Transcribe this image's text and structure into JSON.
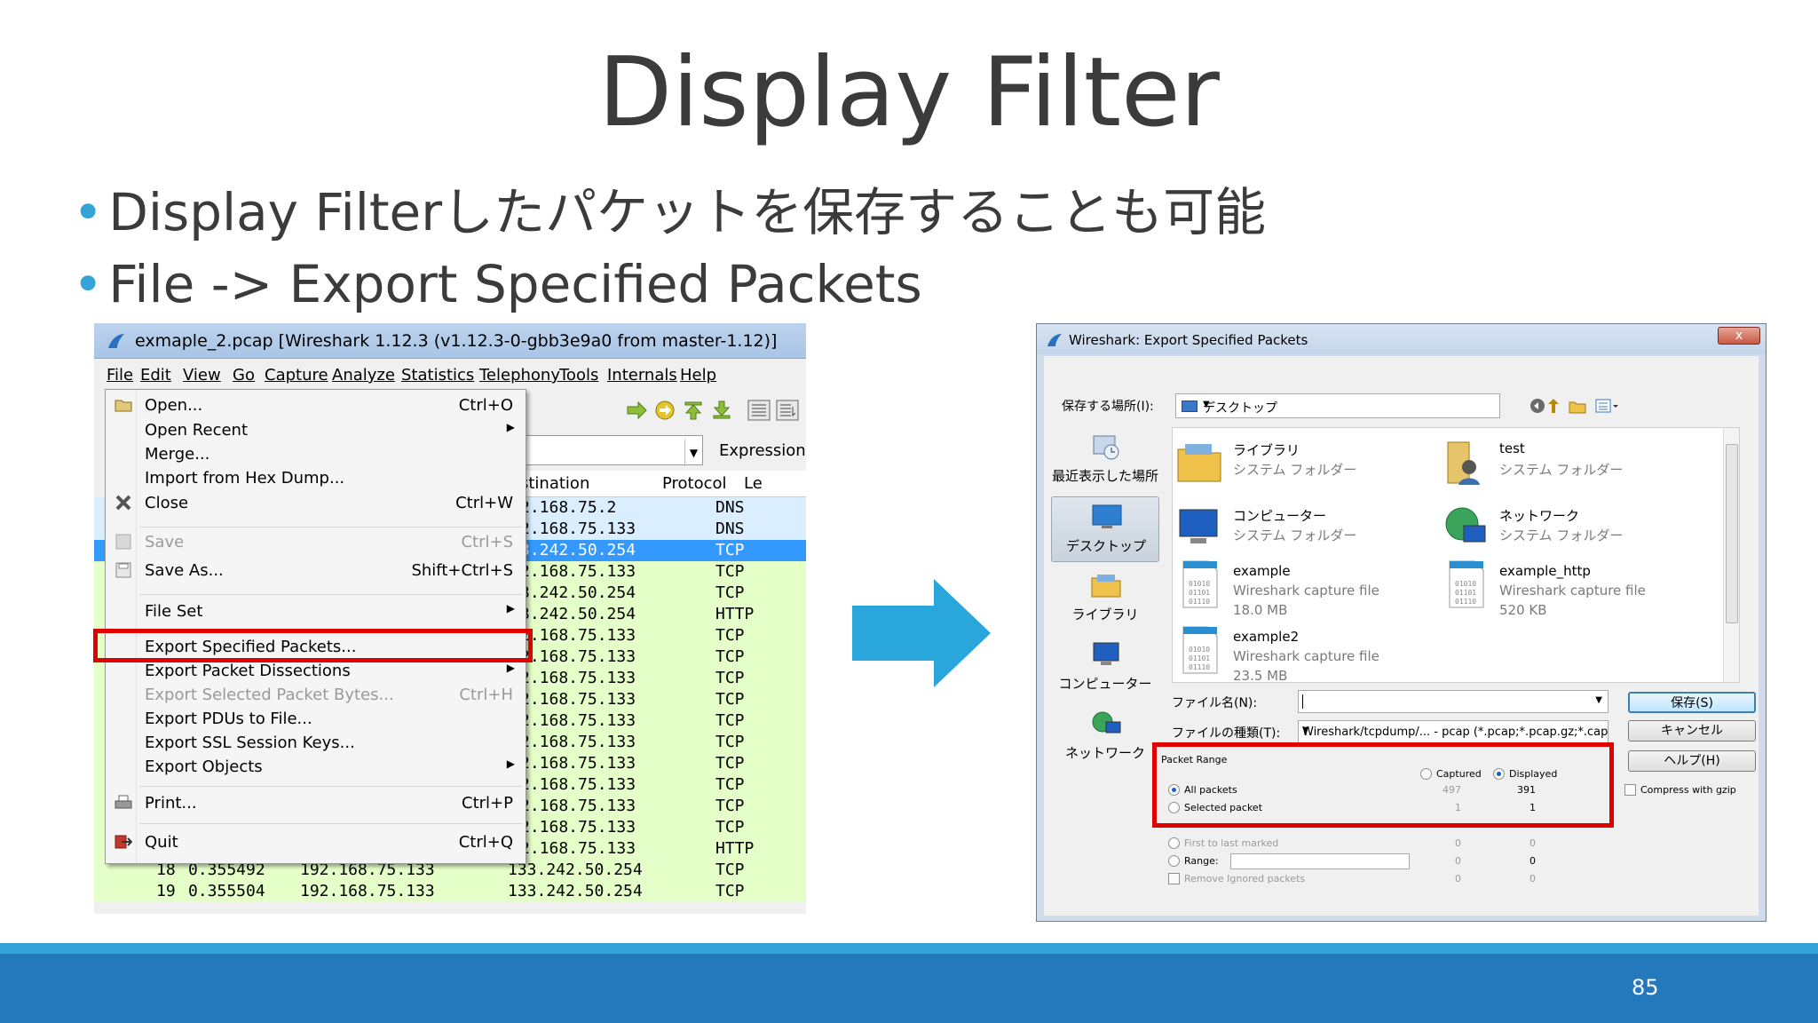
{
  "slide": {
    "title": "Display Filter",
    "bullets": [
      "Display Filterしたパケットを保存することも可能",
      "File -> Export Specified Packets"
    ],
    "page_number": "85"
  },
  "wireshark": {
    "window_title": "exmaple_2.pcap   [Wireshark 1.12.3  (v1.12.3-0-gbb3e9a0 from master-1.12)]",
    "menubar": [
      "File",
      "Edit",
      "View",
      "Go",
      "Capture",
      "Analyze",
      "Statistics",
      "Telephony",
      "Tools",
      "Internals",
      "Help"
    ],
    "filter_expression_label": "Expression...",
    "columns": {
      "destination": "stination",
      "protocol": "Protocol",
      "length": "Le"
    },
    "rows": [
      {
        "dst": "2.168.75.2",
        "proto": "DNS"
      },
      {
        "dst": "2.168.75.133",
        "proto": "DNS"
      },
      {
        "dst": "3.242.50.254",
        "proto": "TCP"
      },
      {
        "dst": "2.168.75.133",
        "proto": "TCP"
      },
      {
        "dst": "3.242.50.254",
        "proto": "TCP"
      },
      {
        "dst": "3.242.50.254",
        "proto": "HTTP"
      },
      {
        "dst": "2.168.75.133",
        "proto": "TCP"
      },
      {
        "dst": "2.168.75.133",
        "proto": "TCP"
      },
      {
        "dst": "2.168.75.133",
        "proto": "TCP"
      },
      {
        "dst": "2.168.75.133",
        "proto": "TCP"
      },
      {
        "dst": "2.168.75.133",
        "proto": "TCP"
      },
      {
        "dst": "2.168.75.133",
        "proto": "TCP"
      },
      {
        "dst": "2.168.75.133",
        "proto": "TCP"
      },
      {
        "dst": "2.168.75.133",
        "proto": "TCP"
      },
      {
        "dst": "2.168.75.133",
        "proto": "TCP"
      },
      {
        "dst": "2.168.75.133",
        "proto": "TCP"
      },
      {
        "dst": "2.168.75.133",
        "proto": "HTTP"
      }
    ],
    "bottom_rows": [
      {
        "no": "18",
        "time": "0.355492",
        "src": "192.168.75.133",
        "dst": "133.242.50.254",
        "proto": "TCP"
      },
      {
        "no": "19",
        "time": "0.355504",
        "src": "192.168.75.133",
        "dst": "133.242.50.254",
        "proto": "TCP"
      }
    ],
    "file_menu": [
      {
        "label": "Open...",
        "shortcut": "Ctrl+O"
      },
      {
        "label": "Open Recent",
        "shortcut": ""
      },
      {
        "label": "Merge...",
        "shortcut": ""
      },
      {
        "label": "Import from Hex Dump...",
        "shortcut": ""
      },
      {
        "label": "Close",
        "shortcut": "Ctrl+W"
      },
      {
        "label": "Save",
        "shortcut": "Ctrl+S"
      },
      {
        "label": "Save As...",
        "shortcut": "Shift+Ctrl+S"
      },
      {
        "label": "File Set",
        "shortcut": ""
      },
      {
        "label": "Export Specified Packets...",
        "shortcut": ""
      },
      {
        "label": "Export Packet Dissections",
        "shortcut": ""
      },
      {
        "label": "Export Selected Packet Bytes...",
        "shortcut": "Ctrl+H"
      },
      {
        "label": "Export PDUs to File...",
        "shortcut": ""
      },
      {
        "label": "Export SSL Session Keys...",
        "shortcut": ""
      },
      {
        "label": "Export Objects",
        "shortcut": ""
      },
      {
        "label": "Print...",
        "shortcut": "Ctrl+P"
      },
      {
        "label": "Quit",
        "shortcut": "Ctrl+Q"
      }
    ]
  },
  "dialog": {
    "title": "Wireshark: Export Specified Packets",
    "close_label": "x",
    "location_label": "保存する場所(I):",
    "location_value": "デスクトップ",
    "places": [
      "最近表示した場所",
      "デスクトップ",
      "ライブラリ",
      "コンピューター",
      "ネットワーク"
    ],
    "files": [
      {
        "name": "ライブラリ",
        "desc": "システム フォルダー",
        "size": ""
      },
      {
        "name": "test",
        "desc": "システム フォルダー",
        "size": ""
      },
      {
        "name": "コンピューター",
        "desc": "システム フォルダー",
        "size": ""
      },
      {
        "name": "ネットワーク",
        "desc": "システム フォルダー",
        "size": ""
      },
      {
        "name": "example",
        "desc": "Wireshark capture file",
        "size": "18.0 MB"
      },
      {
        "name": "example_http",
        "desc": "Wireshark capture file",
        "size": "520 KB"
      },
      {
        "name": "example2",
        "desc": "Wireshark capture file",
        "size": "23.5 MB"
      }
    ],
    "filename_label": "ファイル名(N):",
    "filetype_label": "ファイルの種類(T):",
    "filetype_value": "Wireshark/tcpdump/... - pcap (*.pcap;*.pcap.gz;*.cap",
    "save_button": "保存(S)",
    "cancel_button": "キャンセル",
    "help_button": "ヘルプ(H)",
    "packet_range": {
      "title": "Packet Range",
      "captured_label": "Captured",
      "displayed_label": "Displayed",
      "rows": [
        {
          "label": "All packets",
          "captured": "497",
          "displayed": "391"
        },
        {
          "label": "Selected packet",
          "captured": "1",
          "displayed": "1"
        },
        {
          "label": "First to last marked",
          "captured": "0",
          "displayed": "0"
        },
        {
          "label": "Range:",
          "captured": "0",
          "displayed": "0"
        },
        {
          "label": "Remove Ignored packets",
          "captured": "0",
          "displayed": "0"
        }
      ]
    },
    "compress_label": "Compress with gzip"
  },
  "colors": {
    "accent": "#34a3d8",
    "footer": "#2479bd",
    "highlight": "#e00000",
    "arrow": "#29a6db"
  }
}
